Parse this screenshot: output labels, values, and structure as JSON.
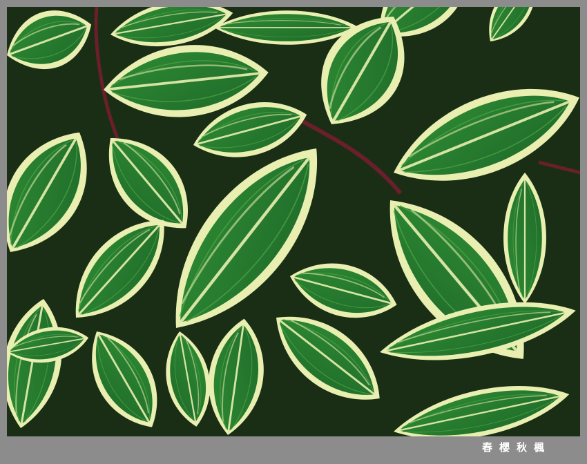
{
  "caption": "春櫻秋楓",
  "photo": {
    "subject_icon": "variegated-leaves-photo",
    "colors": {
      "frame": "#8c8c8c",
      "leaf_dark": "#1f6b2a",
      "leaf_mid": "#2e8a33",
      "leaf_light": "#4fa646",
      "variegation": "#e9efb0",
      "stem": "#6a1f2a",
      "shadow": "#1a2e16"
    }
  }
}
